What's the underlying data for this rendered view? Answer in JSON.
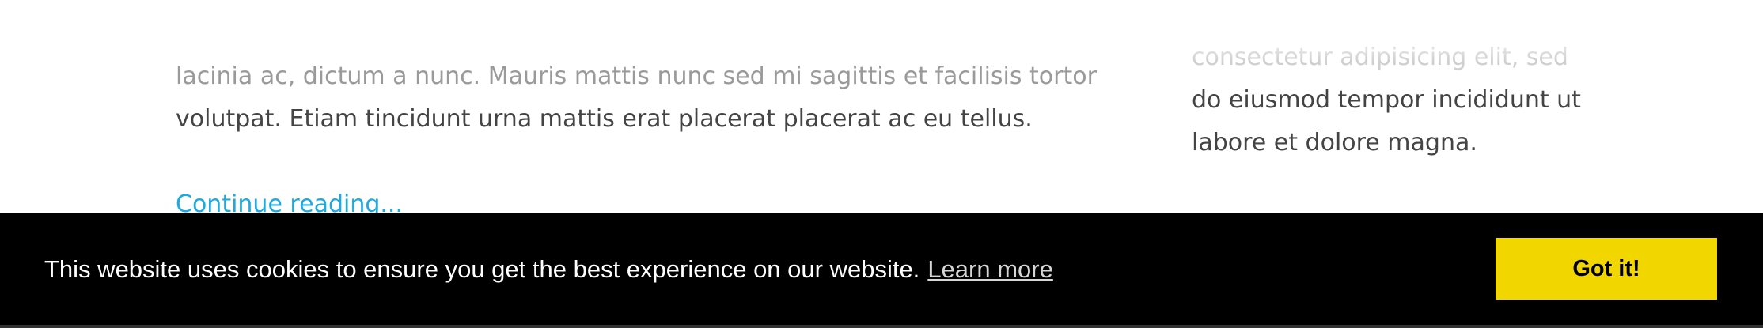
{
  "post": {
    "faded_line": "lacinia ac, dictum a nunc. Mauris mattis nunc sed mi sagittis et facilisis tortor",
    "line": "volutpat. Etiam tincidunt urna mattis erat placerat placerat ac eu tellus.",
    "continue_label": "Continue reading..."
  },
  "sidebar": {
    "faded_line": "consectetur adipisicing elit, sed",
    "line1": "do eiusmod tempor incididunt ut",
    "line2": "labore et dolore magna."
  },
  "cookie_banner": {
    "message": "This website uses cookies to ensure you get the best experience on our website.",
    "learn_more_label": "Learn more",
    "accept_label": "Got it!",
    "background_color": "#000000",
    "button_color": "#f1d600"
  }
}
